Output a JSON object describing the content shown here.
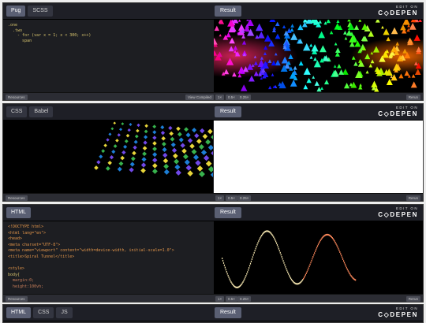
{
  "brand": {
    "edit_on": "EDIT ON",
    "logo": "C◇DEPEN"
  },
  "result_label": "Result",
  "footer": {
    "resources": "Resources",
    "view_compiled": "View Compiled",
    "zoom_1x": "1×",
    "zoom_05x": "0.5×",
    "zoom_025x": "0.25×",
    "rerun": "Rerun"
  },
  "pen1": {
    "tabs": [
      "Pug",
      "SCSS"
    ],
    "code": [
      ".one",
      "  .two",
      "    - for (var x = 1; x < 300; x++)",
      "      span"
    ]
  },
  "pen2": {
    "tabs": [
      "CSS",
      "Babel"
    ]
  },
  "pen3": {
    "tabs": [
      "HTML"
    ],
    "code": [
      "<!DOCTYPE html>",
      "<html lang=\"en\">",
      "<head>",
      "<meta charset=\"UTF-8\">",
      "<meta name=\"viewport\" content=\"width=device-width, initial-scale=1.0\">",
      "<title>Spiral Tunnel</title>",
      "",
      "<style>",
      "body{",
      "  margin:0;",
      "  height:100vh;"
    ]
  },
  "pen4": {
    "tabs": [
      "HTML",
      "CSS",
      "JS"
    ]
  }
}
